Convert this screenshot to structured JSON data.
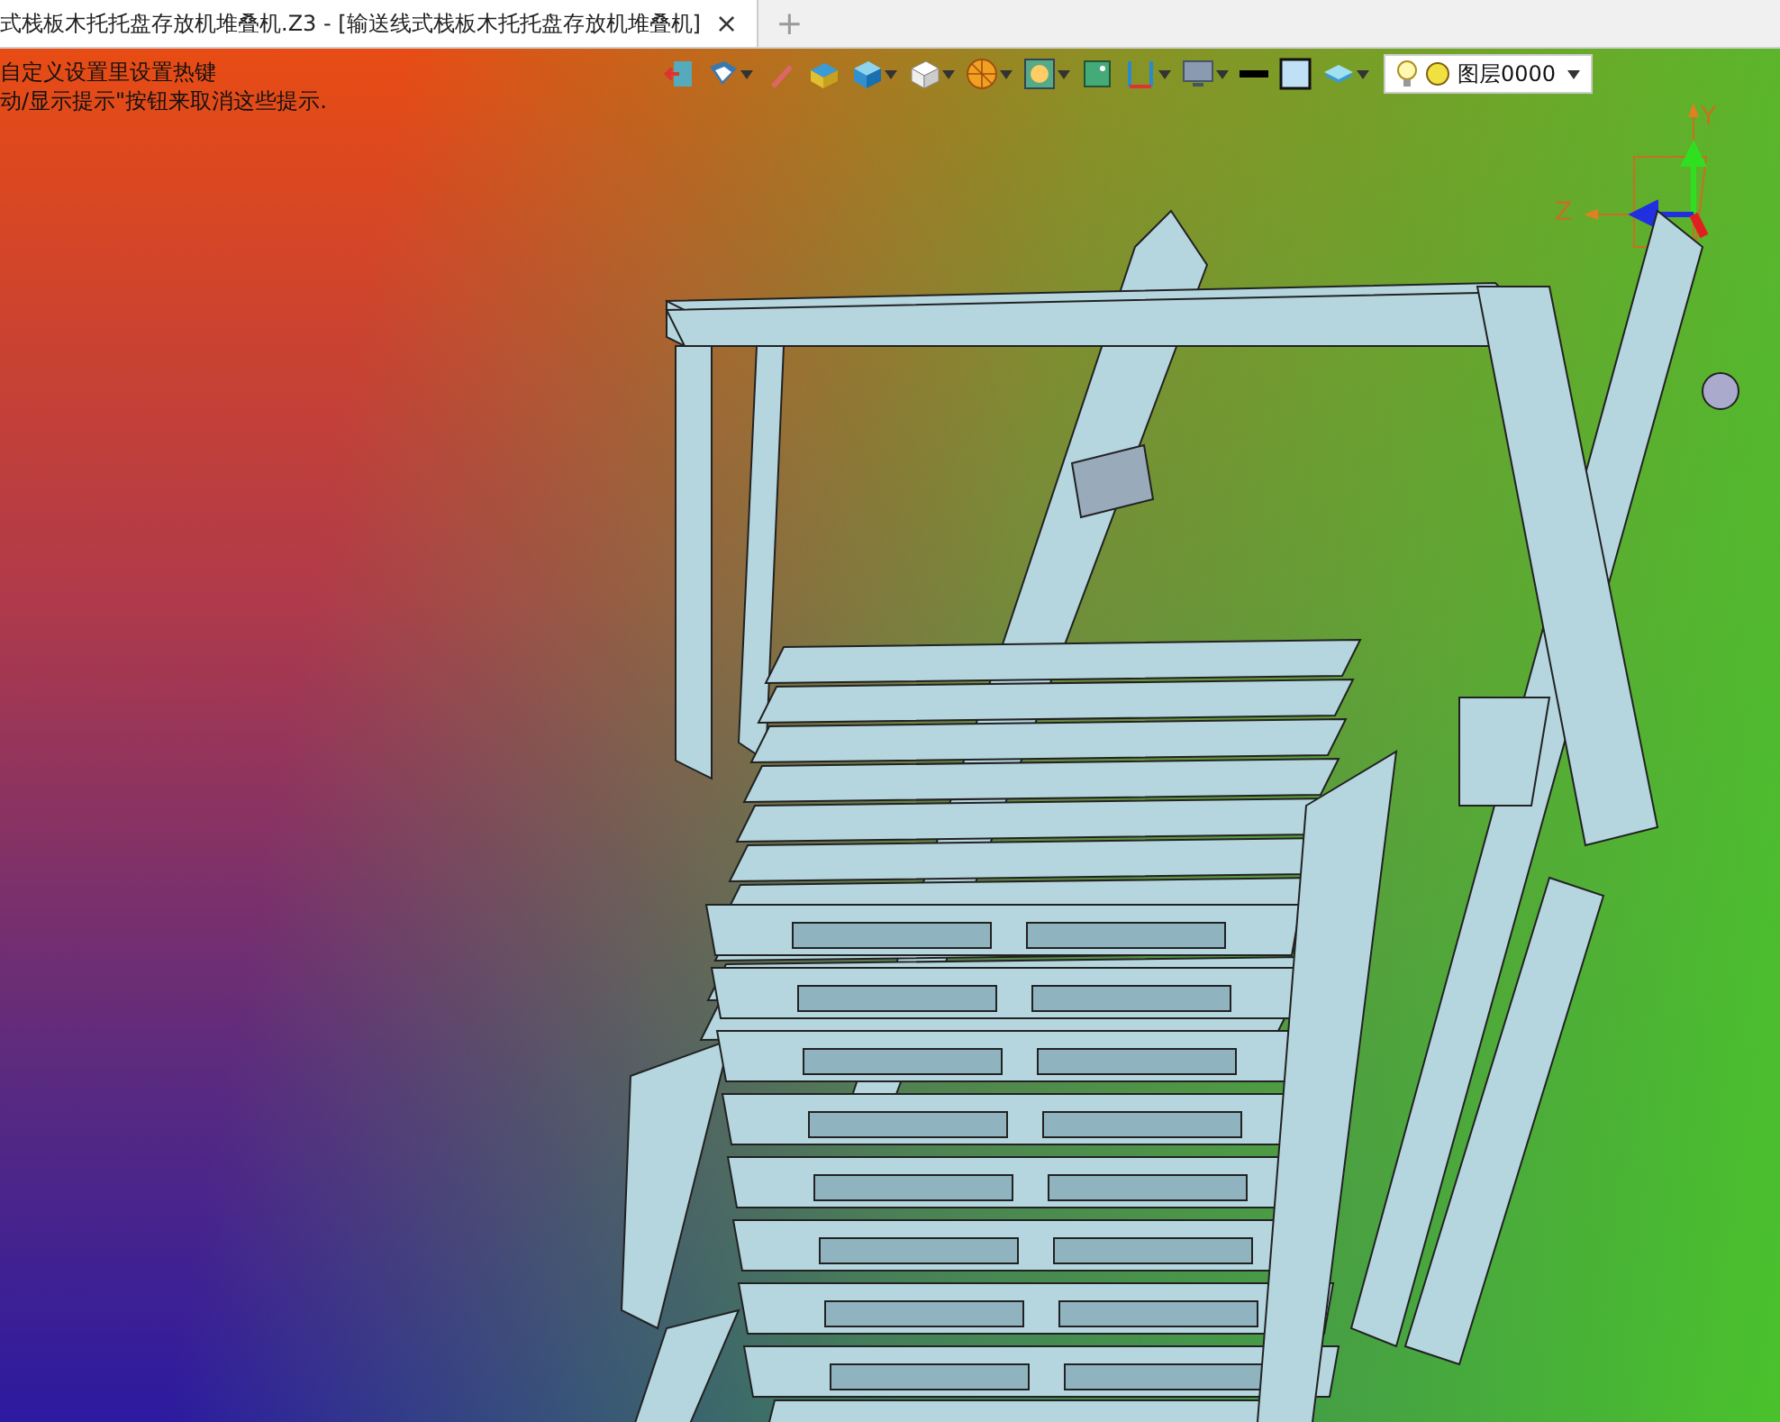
{
  "tab_bar": {
    "tab": {
      "title": "式栈板木托托盘存放机堆叠机.Z3 - [输送线式栈板木托托盘存放机堆叠机]",
      "close": "×"
    },
    "new_tab": "+"
  },
  "hint": [
    "自定义设置里设置热键",
    "动/显示提示\"按钮来取消这些提示."
  ],
  "layer_selector": {
    "value": "图层0000"
  },
  "axes": {
    "y_label": "Y",
    "z_label": "Z"
  }
}
